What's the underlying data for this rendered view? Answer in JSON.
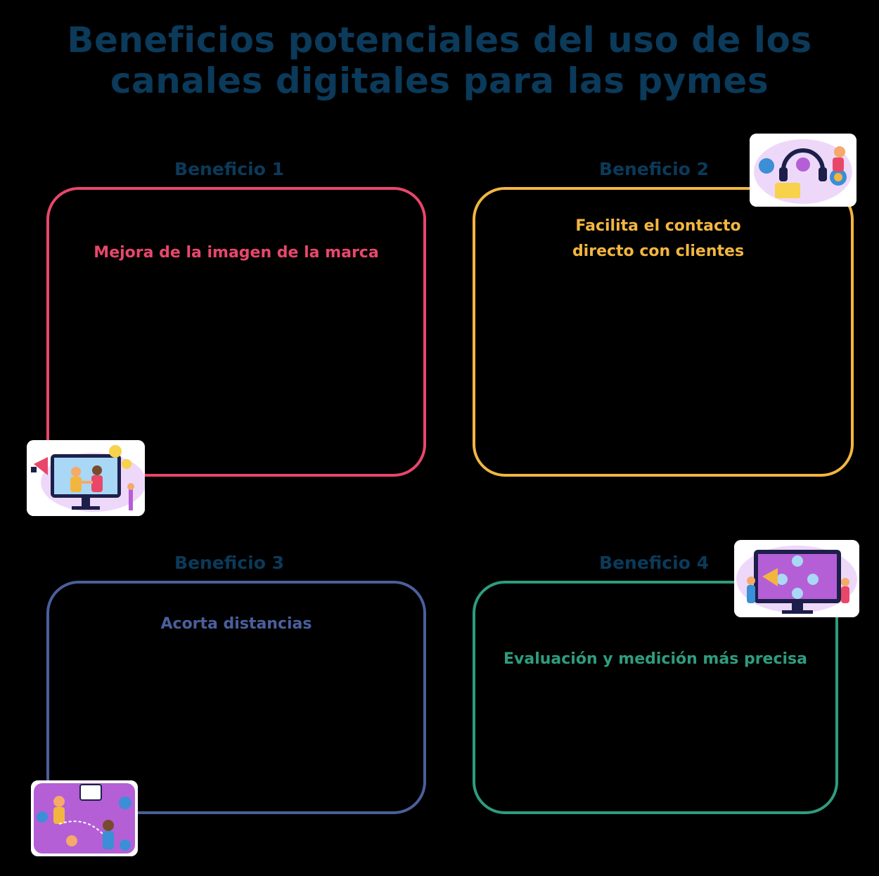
{
  "title": "Beneficios potenciales del uso de los canales digitales para las pymes",
  "colors": {
    "title": "#0b3a5a",
    "benefit_1": "#e8476a",
    "benefit_2": "#f2b640",
    "benefit_3": "#4a5f9c",
    "benefit_4": "#2f9c7e",
    "illustration_purple": "#b45fd6"
  },
  "benefits": [
    {
      "label": "Beneficio 1",
      "text": "Mejora de la imagen de la marca",
      "icon": "marketing-handshake-illustration"
    },
    {
      "label": "Beneficio 2",
      "text": "Facilita el contacto directo con clientes",
      "icon": "customer-support-headset-illustration"
    },
    {
      "label": "Beneficio 3",
      "text": "Acorta distancias",
      "icon": "remote-connection-illustration"
    },
    {
      "label": "Beneficio 4",
      "text": "Evaluación y medición más precisa",
      "icon": "analytics-dashboard-illustration"
    }
  ]
}
